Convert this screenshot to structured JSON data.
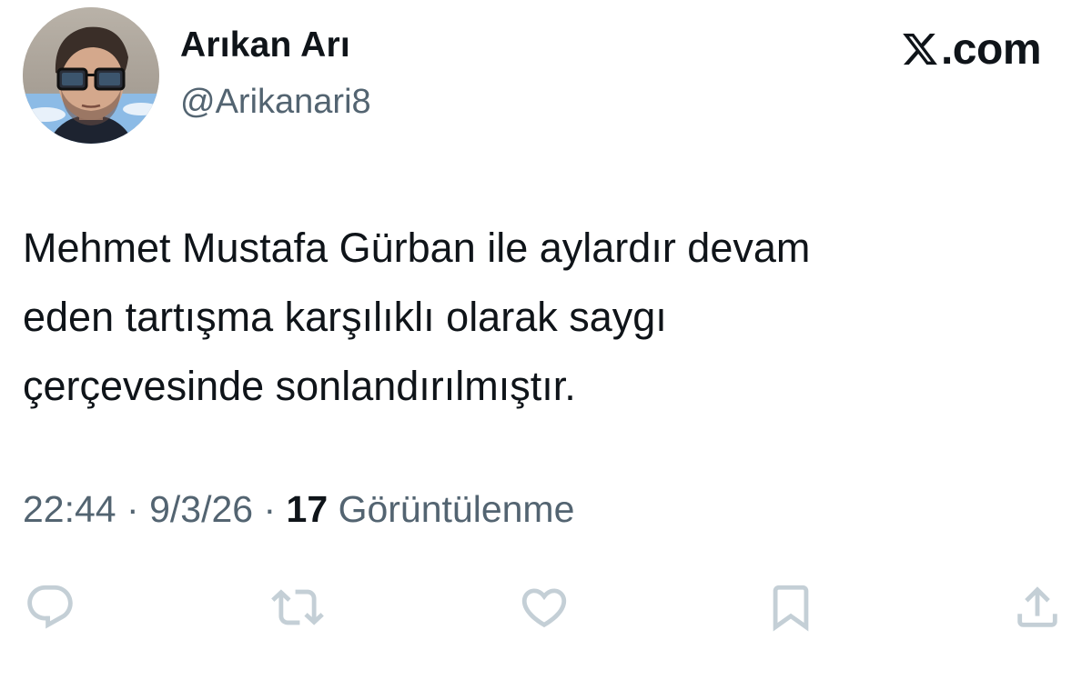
{
  "brand": {
    "text": ".com",
    "logo": "x-logo-icon"
  },
  "author": {
    "display_name": "Arıkan Arı",
    "handle": "@Arikanari8",
    "avatar": "profile-photo"
  },
  "tweet": {
    "text": "Mehmet Mustafa Gürban ile aylardır devam\neden tartışma karşılıklı olarak saygı\nçerçevesinde sonlandırılmıştır.",
    "time": "22:44",
    "separator": "·",
    "date": "9/3/26",
    "views_count": "17",
    "views_label": "Görüntülenme"
  },
  "actions": [
    {
      "icon": "reply-icon"
    },
    {
      "icon": "retweet-icon"
    },
    {
      "icon": "like-icon"
    },
    {
      "icon": "bookmark-icon"
    },
    {
      "icon": "share-icon"
    }
  ],
  "colors": {
    "text_primary": "#0f1419",
    "text_secondary": "#536471",
    "icon_muted": "#c4cfd6",
    "background": "#ffffff"
  }
}
